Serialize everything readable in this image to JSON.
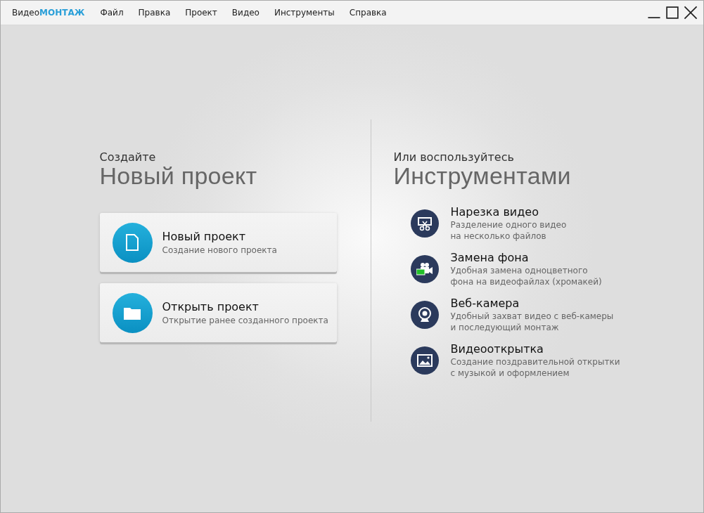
{
  "app": {
    "logo_prefix": "Видео",
    "logo_accent": "МОНТАЖ"
  },
  "menu": [
    "Файл",
    "Правка",
    "Проект",
    "Видео",
    "Инструменты",
    "Справка"
  ],
  "create": {
    "caption": "Создайте",
    "heading": "Новый проект",
    "actions": [
      {
        "kind": "new",
        "title": "Новый проект",
        "subtitle": "Создание нового проекта"
      },
      {
        "kind": "open",
        "title": "Открыть проект",
        "subtitle": "Открытие ранее созданного проекта"
      }
    ]
  },
  "tools": {
    "caption": "Или воспользуйтесь",
    "heading": "Инструментами",
    "items": [
      {
        "kind": "cut",
        "title": "Нарезка видео",
        "lines": [
          "Разделение одного видео",
          "на несколько файлов"
        ]
      },
      {
        "kind": "chroma",
        "title": "Замена фона",
        "lines": [
          "Удобная замена одноцветного",
          "фона на видеофайлах (хромакей)"
        ]
      },
      {
        "kind": "webcam",
        "title": "Веб-камера",
        "lines": [
          "Удобный захват видео с веб-камеры",
          "и последующий монтаж"
        ]
      },
      {
        "kind": "card",
        "title": "Видеооткрытка",
        "lines": [
          "Создание поздравительной открытки",
          "с музыкой и оформлением"
        ]
      }
    ]
  }
}
